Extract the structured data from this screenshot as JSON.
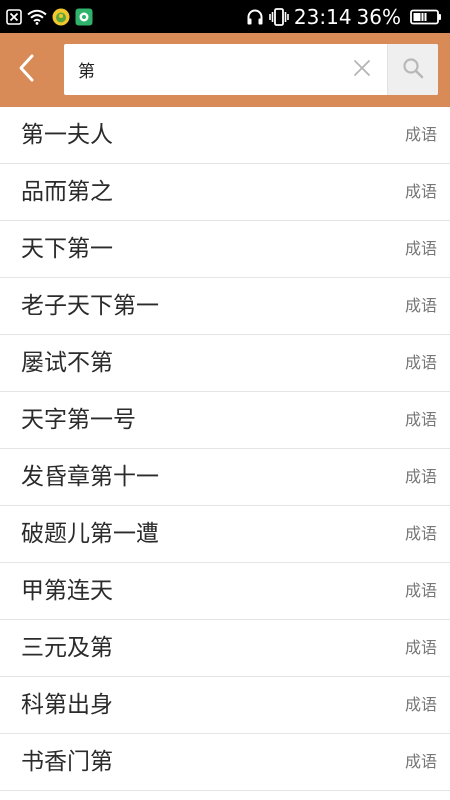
{
  "status_bar": {
    "time": "23:14",
    "battery_percent": "36%",
    "icons": [
      "notification-x-icon",
      "wifi-icon",
      "app-notification-icon",
      "app-notification-icon-2",
      "headphones-icon",
      "vibrate-icon",
      "battery-icon"
    ]
  },
  "header": {
    "back_icon": "chevron-left-icon",
    "search_value": "第",
    "search_placeholder": "",
    "clear_icon": "close-icon",
    "search_icon": "search-icon"
  },
  "results": [
    {
      "title": "第一夫人",
      "tag": "成语"
    },
    {
      "title": "品而第之",
      "tag": "成语"
    },
    {
      "title": "天下第一",
      "tag": "成语"
    },
    {
      "title": "老子天下第一",
      "tag": "成语"
    },
    {
      "title": "屡试不第",
      "tag": "成语"
    },
    {
      "title": "天字第一号",
      "tag": "成语"
    },
    {
      "title": "发昏章第十一",
      "tag": "成语"
    },
    {
      "title": "破题儿第一遭",
      "tag": "成语"
    },
    {
      "title": "甲第连天",
      "tag": "成语"
    },
    {
      "title": "三元及第",
      "tag": "成语"
    },
    {
      "title": "科第出身",
      "tag": "成语"
    },
    {
      "title": "书香门第",
      "tag": "成语"
    }
  ],
  "colors": {
    "header_bg": "#d88a57",
    "status_bar_bg": "#000000",
    "divider": "#e4e4e4",
    "title_text": "#2b2b2b",
    "tag_text": "#777777"
  }
}
